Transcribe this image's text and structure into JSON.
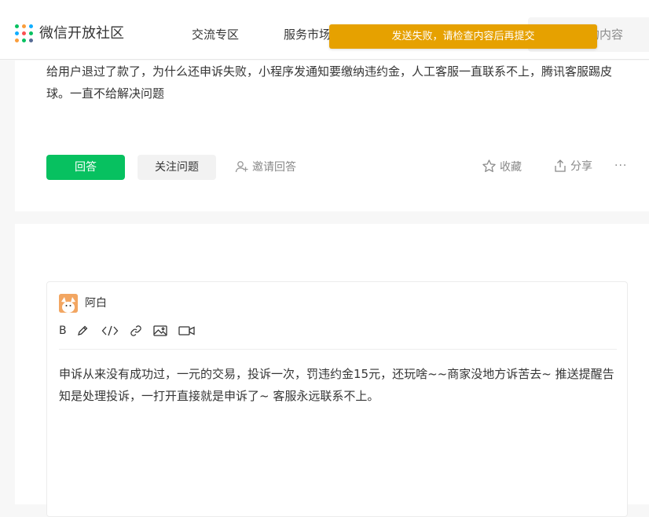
{
  "header": {
    "brand": "微信开放社区",
    "nav": [
      "交流专区",
      "服务市场"
    ],
    "search_placeholder": "的内容",
    "toast": "发送失败，请检查内容后再提交"
  },
  "question": {
    "text": "给用户退过了款了，为什么还申诉失败，小程序发通知要缴纳违约金，人工客服一直联系不上，腾讯客服踢皮球。一直不给解决问题",
    "answer_button": "回答",
    "follow_button": "关注问题",
    "invite": "邀请回答",
    "favorite": "收藏",
    "share": "分享",
    "more": "···"
  },
  "editor": {
    "user": "阿白",
    "toolbar": [
      "B",
      "pen-icon",
      "code-icon",
      "link-icon",
      "image-icon",
      "video-icon"
    ],
    "content": "申诉从来没有成功过，一元的交易，投诉一次，罚违约金15元，还玩啥~~商家没地方诉苦去~  推送提醒告知是处理投诉，一打开直接就是申诉了~ 客服永远联系不上。"
  },
  "colors": {
    "accent": "#07c160",
    "toast": "#e6a100"
  }
}
